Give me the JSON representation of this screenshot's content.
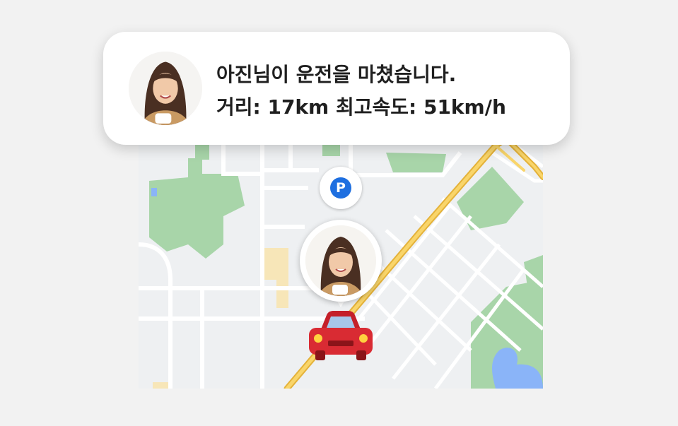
{
  "notification": {
    "line1": "아진님이 운전을 마쳤습니다.",
    "line2": "거리: 17km 최고속도: 51km/h",
    "avatar_icon": "user-photo"
  },
  "map": {
    "parking_label": "P",
    "parking_icon": "parking-icon",
    "car_icon": "red-car-icon",
    "pin_icon": "user-location-pin",
    "colors": {
      "background": "#eef0f2",
      "park": "#a8d5a9",
      "road": "#ffffff",
      "highway": "#f6c342",
      "water": "#8ab4f8",
      "building": "#f7e6b8",
      "parking": "#1e6fe0",
      "car": "#d92b33"
    }
  }
}
